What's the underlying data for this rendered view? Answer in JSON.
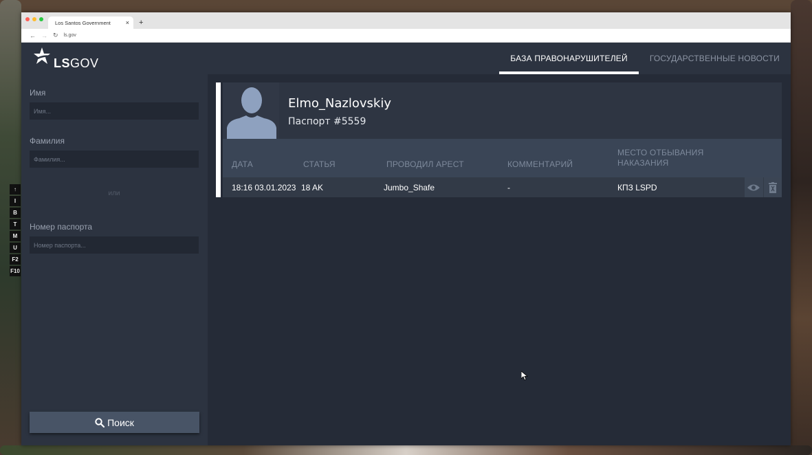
{
  "browser": {
    "tab_title": "Los Santos Government",
    "tab_close": "×",
    "new_tab": "+",
    "url": "ls.gov"
  },
  "header": {
    "logo_bold": "LS",
    "logo_light": "GOV",
    "nav": [
      {
        "label": "БАЗА ПРАВОНАРУШИТЕЛЕЙ",
        "active": true
      },
      {
        "label": "ГОСУДАРСТВЕННЫЕ НОВОСТИ",
        "active": false
      }
    ]
  },
  "search": {
    "first_name_label": "Имя",
    "first_name_placeholder": "Имя...",
    "last_name_label": "Фамилия",
    "last_name_placeholder": "Фамилия...",
    "or_text": "или",
    "passport_label": "Номер паспорта",
    "passport_placeholder": "Номер паспорта...",
    "search_button": "Поиск"
  },
  "profile": {
    "name": "Elmo_Nazlovskiy",
    "passport": "Паспорт #5559"
  },
  "table": {
    "headers": [
      "ДАТА",
      "СТАТЬЯ",
      "ПРОВОДИЛ АРЕСТ",
      "КОММЕНТАРИЙ",
      "МЕСТО ОТБЫВАНИЯ",
      "НАКАЗАНИЯ"
    ],
    "rows": [
      {
        "date": "18:16 03.01.2023",
        "article": "18 AK",
        "officer": "Jumbo_Shafe",
        "comment": "-",
        "place": "КПЗ LSPD"
      }
    ]
  },
  "hud": {
    "keys": [
      "↑",
      "I",
      "B",
      "T",
      "M",
      "U",
      "F2",
      "F10"
    ]
  },
  "colors": {
    "accent": "#ffffff",
    "panel": "#2c3340",
    "table_head": "#3a4556",
    "button": "#485466"
  }
}
